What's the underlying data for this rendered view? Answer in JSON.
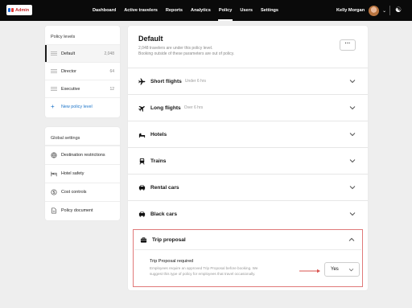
{
  "logo": {
    "text": "Admin"
  },
  "nav": {
    "items": [
      "Dashboard",
      "Active travelers",
      "Reports",
      "Analytics",
      "Policy",
      "Users",
      "Settings"
    ],
    "active": "Policy"
  },
  "user": {
    "name": "Kelly Morgan"
  },
  "sidebar": {
    "levels_title": "Policy levels",
    "levels": [
      {
        "label": "Default",
        "count": "2,048"
      },
      {
        "label": "Director",
        "count": "64"
      },
      {
        "label": "Executive",
        "count": "12"
      }
    ],
    "new_level": "New policy level",
    "global_title": "Global settings",
    "global_items": [
      {
        "label": "Destination restrictions",
        "icon": "globe-icon"
      },
      {
        "label": "Hotel safety",
        "icon": "bed-icon"
      },
      {
        "label": "Cost controls",
        "icon": "money-icon"
      },
      {
        "label": "Policy document",
        "icon": "document-icon"
      }
    ]
  },
  "main": {
    "title": "Default",
    "subtitle_line1": "2,048 travelers are under this policy level.",
    "subtitle_line2": "Booking outside of these parameters are out of policy.",
    "more_label": "···",
    "sections": [
      {
        "label": "Short flights",
        "note": "Under 6 hrs",
        "icon": "plane-icon"
      },
      {
        "label": "Long flights",
        "note": "Over 6 hrs",
        "icon": "plane-icon"
      },
      {
        "label": "Hotels",
        "note": "",
        "icon": "bed-icon"
      },
      {
        "label": "Trains",
        "note": "",
        "icon": "train-icon"
      },
      {
        "label": "Rental cars",
        "note": "",
        "icon": "car-icon"
      },
      {
        "label": "Black cars",
        "note": "",
        "icon": "car-icon"
      }
    ],
    "trip": {
      "label": "Trip proposal",
      "icon": "briefcase-icon",
      "req_title": "Trip Proposal required",
      "req_desc_line1": "Employees require an approved Trip Proposal before booking. We",
      "req_desc_line2": "suggest this type of policy for employees that travel occasionally.",
      "select_value": "Yes"
    }
  },
  "colors": {
    "nav_bg": "#0a0a0a",
    "highlight": "#e07a7a",
    "arrow": "#d9534f",
    "link": "#1a73c8"
  }
}
